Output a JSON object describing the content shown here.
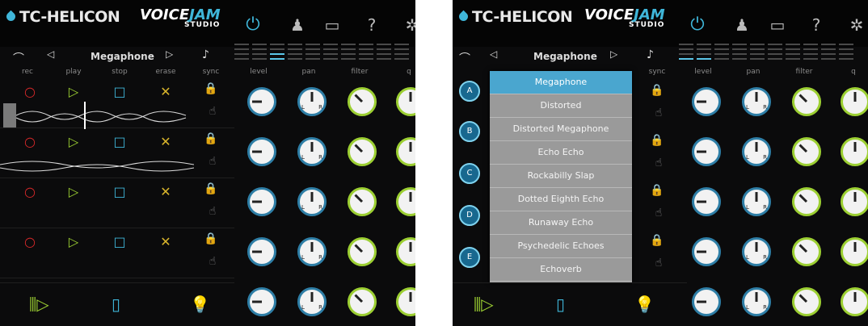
{
  "brand": {
    "name": "TC-HELICON",
    "voice": "VOICE",
    "jam": "JAM",
    "studio": "STUDIO"
  },
  "nav": {
    "preset": "Megaphone"
  },
  "labels": {
    "rec": "rec",
    "play": "play",
    "stop": "stop",
    "erase": "erase",
    "sync": "sync",
    "level": "level",
    "pan": "pan",
    "filter": "filter",
    "q": "q"
  },
  "dropdown": [
    "Megaphone",
    "Distorted",
    "Distorted Megaphone",
    "Echo Echo",
    "Rockabilly Slap",
    "Dotted Eighth Echo",
    "Runaway Echo",
    "Psychedelic Echoes",
    "Echoverb"
  ],
  "slots": [
    "A",
    "B",
    "C",
    "D",
    "E"
  ],
  "pan_lr": {
    "l": "L",
    "r": "R"
  },
  "colors": {
    "accent": "#3fb6d9",
    "rec": "#d7282a",
    "play": "#9ccf32",
    "erase": "#d9b52b",
    "background": "#0b0b0c"
  },
  "icons": {
    "power": "power-icon",
    "user": "user-icon",
    "folder": "folder-icon",
    "help": "help-icon",
    "settings": "gear-icon"
  },
  "meter": {
    "left_active_column": 3,
    "right_active_columns": [
      1,
      2
    ]
  }
}
